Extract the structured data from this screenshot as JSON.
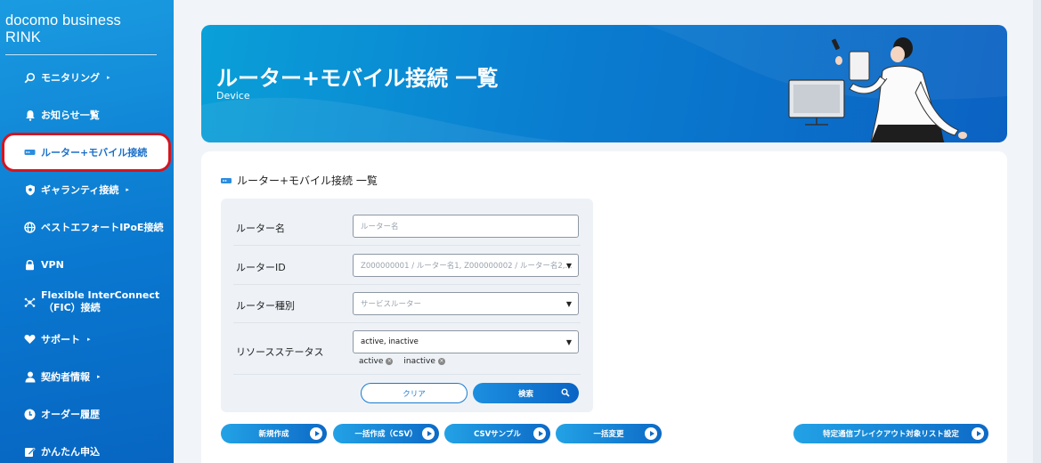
{
  "brand": "docomo business RINK",
  "sidebar": {
    "items": [
      {
        "label": "モニタリング",
        "icon": "monitor-search-icon",
        "arrow": "▸"
      },
      {
        "label": "お知らせ一覧",
        "icon": "bell-icon",
        "arrow": ""
      },
      {
        "label": "ルーター+モバイル接続",
        "icon": "router-icon",
        "arrow": ""
      },
      {
        "label": "ギャランティ接続",
        "icon": "shield-icon",
        "arrow": "▸"
      },
      {
        "label": "ベストエフォートIPoE接続",
        "icon": "globe-icon",
        "arrow": ""
      },
      {
        "label": "VPN",
        "icon": "lock-icon",
        "arrow": ""
      },
      {
        "label_line1": "Flexible InterConnect",
        "label_line2": "（FIC）接続",
        "icon": "network-icon"
      },
      {
        "label": "サポート",
        "icon": "support-icon",
        "arrow": "▸"
      },
      {
        "label": "契約者情報",
        "icon": "user-icon",
        "arrow": "▸"
      },
      {
        "label": "オーダー履歴",
        "icon": "clock-icon",
        "arrow": ""
      },
      {
        "label": "かんたん申込",
        "icon": "edit-icon",
        "arrow": ""
      }
    ]
  },
  "hero": {
    "title": "ルーター+モバイル接続 一覧",
    "subtitle": "Device"
  },
  "panel": {
    "title": "ルーター+モバイル接続 一覧"
  },
  "form": {
    "router_name": {
      "label": "ルーター名",
      "placeholder": "ルーター名"
    },
    "router_id": {
      "label": "ルーターID",
      "placeholder": "Z000000001 / ルーター名1, Z000000002 / ルーター名2,..."
    },
    "router_type": {
      "label": "ルーター種別",
      "placeholder": "サービスルーター"
    },
    "resource_status": {
      "label": "リソースステータス",
      "value": "active, inactive",
      "chips": [
        "active",
        "inactive"
      ]
    },
    "clear_label": "クリア",
    "search_label": "検索"
  },
  "actions": [
    "新規作成",
    "一括作成（CSV）",
    "CSVサンプル",
    "一括変更",
    "特定通信ブレイクアウト対象リスト設定"
  ],
  "colors": {
    "accent": "#0a78d0",
    "active_border": "#d6141f"
  }
}
